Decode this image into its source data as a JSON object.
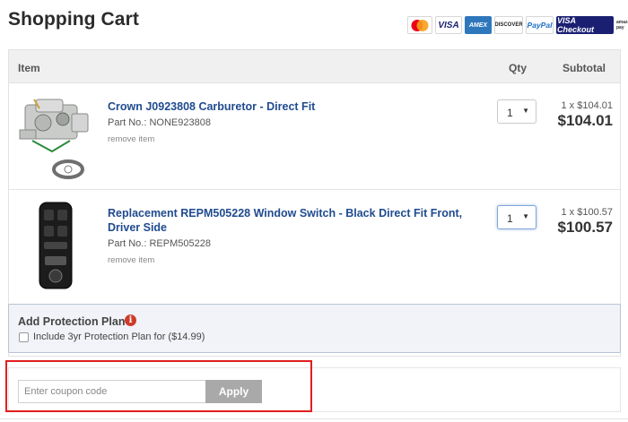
{
  "page": {
    "title": "Shopping Cart"
  },
  "payment_logos": [
    {
      "name": "mastercard-logo",
      "label": "MasterCard"
    },
    {
      "name": "visa-logo",
      "label": "VISA"
    },
    {
      "name": "amex-logo",
      "label": "AMEX"
    },
    {
      "name": "discover-logo",
      "label": "DISCOVER"
    },
    {
      "name": "paypal-logo",
      "label": "PayPal"
    },
    {
      "name": "visa-checkout-logo",
      "label": "VISA Checkout"
    },
    {
      "name": "amazon-pay-logo",
      "label": "amazon pay"
    }
  ],
  "cart": {
    "columns": {
      "item": "Item",
      "qty": "Qty",
      "subtotal": "Subtotal"
    },
    "items": [
      {
        "name": "Crown J0923808 Carburetor - Direct Fit",
        "part_label": "Part No.: NONE923808",
        "remove_label": "remove item",
        "qty": "1",
        "unit_price": "1 x $104.01",
        "subtotal": "$104.01"
      },
      {
        "name": "Replacement REPM505228 Window Switch - Black Direct Fit Front, Driver Side",
        "part_label": "Part No.: REPM505228",
        "remove_label": "remove item",
        "qty": "1",
        "unit_price": "1 x $100.57",
        "subtotal": "$100.57"
      }
    ]
  },
  "protection": {
    "title": "Add Protection Plan",
    "info_icon": "i",
    "checkbox_label": "Include 3yr Protection Plan for ($14.99)",
    "checked": false
  },
  "coupon": {
    "placeholder": "Enter coupon code",
    "value": "",
    "apply_label": "Apply"
  },
  "colors": {
    "link": "#1f4b8f",
    "highlight": "#e01e1e",
    "apply_button": "#a9a9a9",
    "info_icon": "#cf3b2a"
  }
}
